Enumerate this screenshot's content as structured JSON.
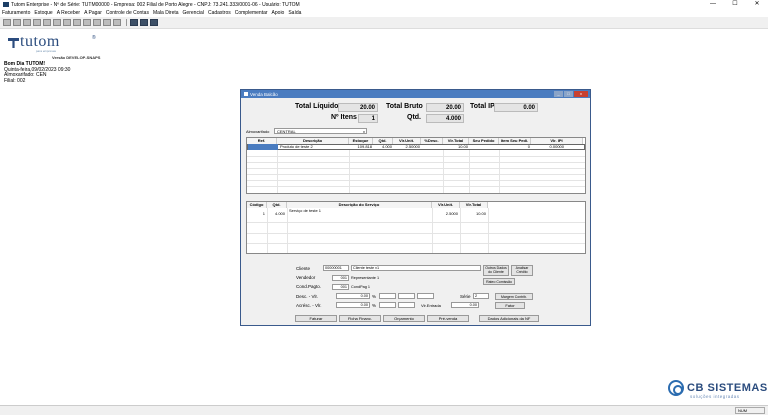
{
  "app": {
    "title": "Tutom Enterprise - Nº de Série: TUTM00000 - Empresa: 002 Filial de Porto Alegre - CNPJ: 73.241.333/0001-06 - Usuário: TUTOM",
    "window_controls": [
      "—",
      "☐",
      "✕"
    ]
  },
  "menu": [
    "Faturamento",
    "Estoque",
    "A Receber",
    "A Pagar",
    "Controle de Contas",
    "Mala Direta",
    "Gerencial",
    "Cadastros",
    "Complementar",
    "Apoio",
    "Saída"
  ],
  "logo": {
    "word": "tutom",
    "reg": "®",
    "sub": "para empresas",
    "version": "Versão DEVELOP-SNAPS"
  },
  "info": {
    "greeting": "Bom Dia TUTOM!",
    "date": "Quinta-feira,09/02/2023  09:30",
    "almox": "Almoxarifado: CEN",
    "filial": "Filial: 002"
  },
  "window": {
    "title": "Venda Balcão",
    "total_liquido_label": "Total Líquido",
    "total_liquido": "20.00",
    "total_bruto_label": "Total Bruto",
    "total_bruto": "20.00",
    "total_ipi_label": "Total IPI",
    "total_ipi": "0.00",
    "n_itens_label": "Nº Itens",
    "n_itens": "1",
    "qtd_label": "Qtd.",
    "qtd": "4.000",
    "almoxarifado_label": "Almoxarifado",
    "almoxarifado": "CENTRAL",
    "items_headers": [
      "Ref.",
      "Descrição",
      "Estoque",
      "Qtd.",
      "Vlr.Unit.",
      "%Desc.",
      "Vlr.Total",
      "Seu Pedido",
      "Item Seu Pedi.",
      "Vlr. IPI"
    ],
    "item_row": {
      "ref": "",
      "desc": "Produto de teste 2",
      "estoque": "109.818",
      "qtd": "4.000",
      "unit": "2.50000",
      "desc_pct": "",
      "total": "10.00",
      "seu_pedido": "",
      "item_seu": "0",
      "ipi": "0.00000"
    },
    "serv_headers": [
      "Código",
      "Qtd.",
      "Descrição do Serviço",
      "Vlr.Unit.",
      "Vlr.Total"
    ],
    "serv_row": {
      "codigo": "1",
      "qtd": "4.000",
      "desc": "Serviço de teste 1",
      "unit": "2.5000",
      "total": "10.00"
    },
    "cliente_label": "Cliente",
    "cliente_code": "00000001",
    "cliente_name": "Cliente teste v1",
    "vendedor_label": "Vendedor",
    "vendedor_code": "001",
    "vendedor_name": "Representante 1",
    "cond_label": "Cond.Pagto.",
    "cond_code": "001",
    "cond_name": "CondPag 1",
    "desc_label": "Desc. - Vlr.",
    "desc_val": "0.00",
    "acres_label": "Acrésc. - Vlr.",
    "acres_val": "0.00",
    "pct": "%",
    "vlr_entrada_label": "Vlr.Entrada",
    "vlr_entrada": "0.00",
    "serie_label": "Série",
    "serie": "2",
    "outros_dados": "Outros Dados do Cliente",
    "analisar": "Analisar Crédito",
    "rateo": "Rateo Comissão",
    "margem": "Margem Contrib.",
    "fator": "Fator",
    "buttons": [
      "Faturar",
      "Ficha Financ.",
      "Orçamento",
      "Pré-venda",
      "Dados Adicionais da NF"
    ]
  },
  "status": {
    "num": "NUM"
  },
  "cb": {
    "name": "CB SISTEMAS",
    "sub": "soluções integradas"
  }
}
